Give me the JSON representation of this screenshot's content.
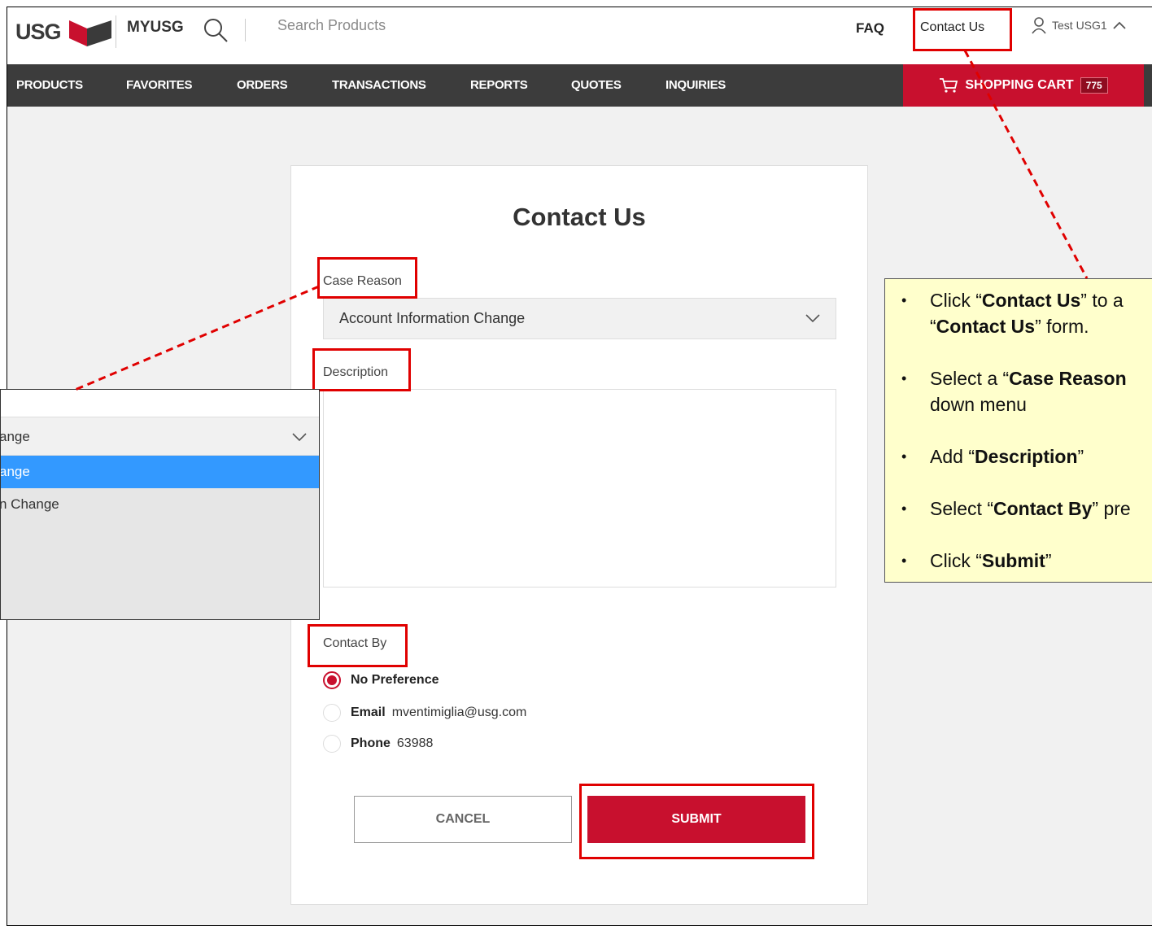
{
  "header": {
    "logo": "USG",
    "app_name": "MYUSG",
    "search_placeholder": "Search Products",
    "faq": "FAQ",
    "contact_us": "Contact Us",
    "user_name": "Test USG1",
    "icons": [
      "usg-logo-icon",
      "search-icon",
      "user-icon",
      "chevron-up-icon",
      "cart-icon",
      "chevron-down-icon"
    ]
  },
  "nav": {
    "items": [
      "PRODUCTS",
      "FAVORITES",
      "ORDERS",
      "TRANSACTIONS",
      "REPORTS",
      "QUOTES",
      "INQUIRIES"
    ],
    "cart_label": "SHOPPING CART",
    "cart_count": "775"
  },
  "form": {
    "title": "Contact Us",
    "case_reason_label": "Case Reason",
    "case_reason_value": "Account Information Change",
    "description_label": "Description",
    "contact_by_label": "Contact By",
    "options": [
      {
        "name": "No Preference",
        "value": "",
        "selected": true
      },
      {
        "name": "Email",
        "value": "mventimiglia@usg.com",
        "selected": false
      },
      {
        "name": "Phone",
        "value": "63988",
        "selected": false
      }
    ],
    "cancel": "CANCEL",
    "submit": "SUBMIT"
  },
  "dropdown_inset": {
    "selected_text": "ange",
    "options": [
      "ange",
      "n Change"
    ]
  },
  "callout": {
    "steps": [
      {
        "pre": "Click “",
        "bold": "Contact Us",
        "post": "” to a",
        "line2_pre": "“",
        "line2_bold": "Contact Us",
        "line2_post": "” form."
      },
      {
        "pre": "Select a “",
        "bold": "Case Reason",
        "post": "",
        "line2_pre": "down menu",
        "line2_bold": "",
        "line2_post": ""
      },
      {
        "pre": "Add “",
        "bold": "Description",
        "post": "”"
      },
      {
        "pre": "Select “",
        "bold": "Contact By",
        "post": "” pre"
      },
      {
        "pre": "Click “",
        "bold": "Submit",
        "post": "”"
      }
    ]
  },
  "colors": {
    "brand_red": "#c8102e",
    "nav_bg": "#3c3c3c",
    "annotation_red": "#e00000",
    "callout_bg": "#ffffcc",
    "highlight_blue": "#3399ff"
  }
}
